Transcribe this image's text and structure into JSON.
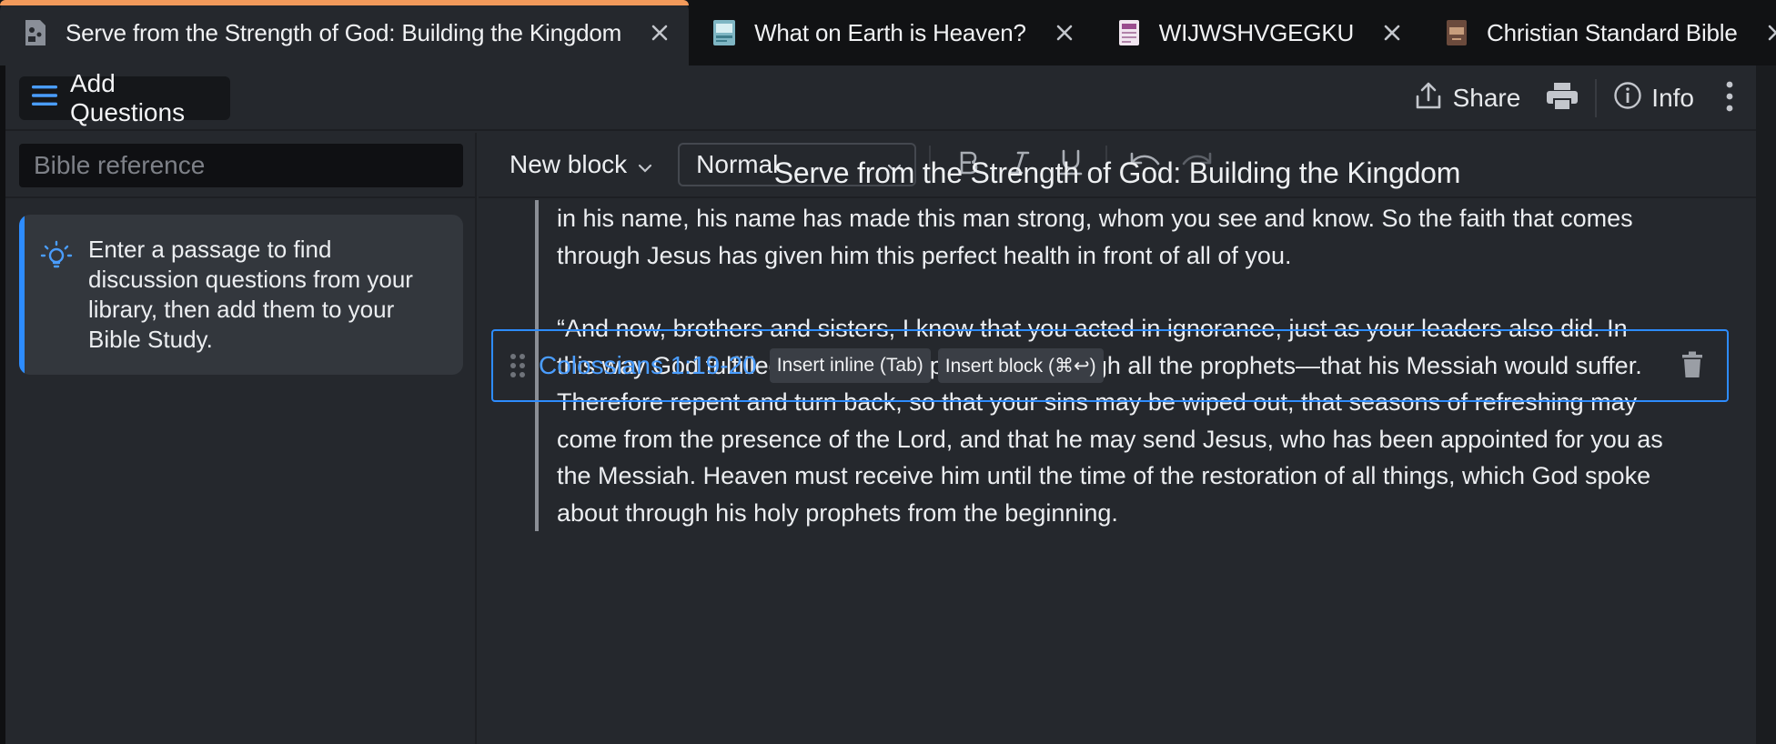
{
  "tabs": [
    {
      "label": "Serve from the Strength of God: Building the Kingdom",
      "active": true
    },
    {
      "label": "What on Earth is Heaven?",
      "active": false
    },
    {
      "label": "WIJWSHVGEGKU",
      "active": false
    },
    {
      "label": "Christian Standard Bible",
      "active": false
    }
  ],
  "toolbar": {
    "add_questions_label": "Add Questions",
    "share_label": "Share",
    "info_label": "Info"
  },
  "sidebar": {
    "search_placeholder": "Bible reference",
    "tip_text": "Enter a passage to find discussion questions from your library, then add them to your Bible Study."
  },
  "format_bar": {
    "new_block_label": "New block",
    "style_value": "Normal"
  },
  "document": {
    "title": "Serve from the Strength of God: Building the Kingdom",
    "quote_paragraphs": [
      "in his name, his name has made this man strong, whom you see and know. So the faith that comes through Jesus has given him this perfect health in front of all of you.",
      "“And now, brothers and sisters, I know that you acted in ignorance, just as your leaders also did. In this way God fulfilled what he had predicted through all the prophets—that his Messiah would suffer. Therefore repent and turn back, so that your sins may be wiped out, that seasons of refreshing may come from the presence of the Lord, and that he may send Jesus, who has been appointed for you as the Messiah. Heaven must receive him until the time of the restoration of all things, which God spoke about through his holy prophets from the beginning."
    ],
    "reference_block": {
      "reference": "Colossians 1:19-20",
      "insert_inline_label": "Insert inline (Tab)",
      "insert_block_label": "Insert block (⌘↩)"
    }
  },
  "colors": {
    "accent": "#2d8cff",
    "active_tab_indicator": "#f29a5b",
    "background": "#25282d"
  },
  "icons": [
    "study-icon",
    "heaven-book-icon",
    "document-icon",
    "book-icon",
    "close-icon",
    "plus-icon",
    "hamburger-icon",
    "share-icon",
    "print-icon",
    "info-icon",
    "kebab-icon",
    "lightbulb-icon",
    "chevron-down-icon",
    "bold-icon",
    "italic-icon",
    "underline-icon",
    "undo-icon",
    "redo-icon",
    "drag-handle-icon",
    "trash-icon"
  ]
}
